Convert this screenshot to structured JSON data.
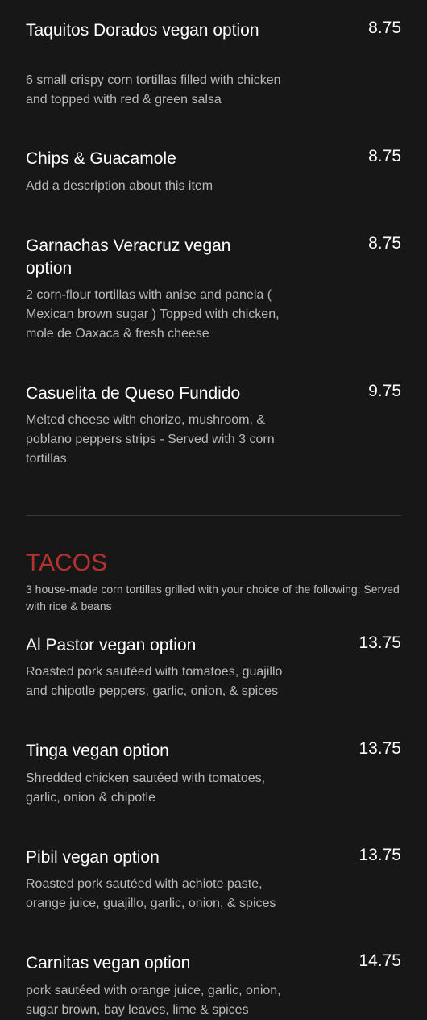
{
  "colors": {
    "background": "#171717",
    "text": "#ffffff",
    "description": "#b9b9b9",
    "section_title": "#b4312e",
    "divider": "#3a3a3a"
  },
  "items": [
    {
      "name": "Taquitos Dorados vegan option",
      "price": "8.75",
      "description": "6 small crispy corn tortillas filled with chicken and topped with red & green salsa"
    },
    {
      "name": "Chips & Guacamole",
      "price": "8.75",
      "description": "Add a description about this item"
    },
    {
      "name": "Garnachas Veracruz vegan option",
      "price": "8.75",
      "description": "2 corn-flour tortillas with anise and panela ( Mexican brown sugar ) Topped with chicken, mole de Oaxaca & fresh cheese"
    },
    {
      "name": "Casuelita de Queso Fundido",
      "price": "9.75",
      "description": "Melted cheese with chorizo, mushroom, & poblano peppers strips - Served with 3 corn tortillas"
    }
  ],
  "section": {
    "title": "TACOS",
    "description": "3 house-made corn tortillas grilled with your choice of the following: Served with rice & beans"
  },
  "tacos": [
    {
      "name": "Al Pastor vegan option",
      "price": "13.75",
      "description": "Roasted pork sautéed with tomatoes, guajillo and chipotle peppers, garlic, onion, & spices"
    },
    {
      "name": "Tinga vegan option",
      "price": "13.75",
      "description": "Shredded chicken sautéed with tomatoes, garlic, onion & chipotle"
    },
    {
      "name": "Pibil vegan option",
      "price": "13.75",
      "description": "Roasted pork sautéed with achiote paste, orange juice, guajillo, garlic, onion, & spices"
    },
    {
      "name": "Carnitas vegan option",
      "price": "14.75",
      "description": "pork sautéed with orange juice, garlic, onion, sugar brown, bay leaves, lime & spices"
    }
  ]
}
